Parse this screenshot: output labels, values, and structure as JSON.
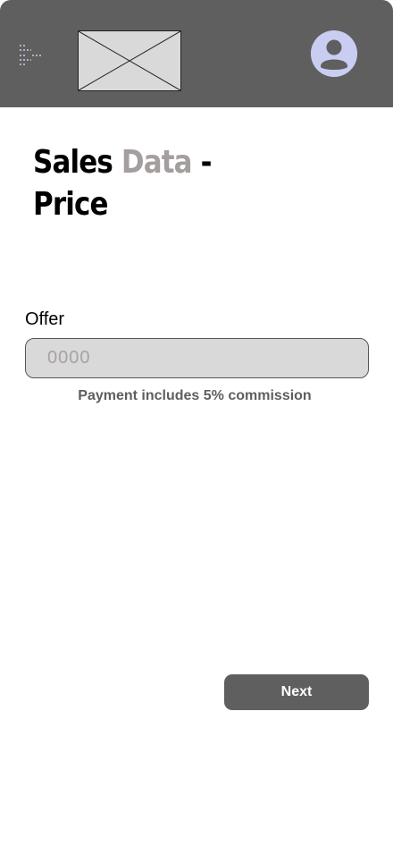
{
  "header": {
    "menu_icon": "menu-icon",
    "logo_icon": "image-placeholder-icon",
    "avatar_icon": "user-avatar-icon",
    "background": "#5f5f5f",
    "avatar_color": "#c9cdf1"
  },
  "title": {
    "word1": "Sales",
    "word2": "Data",
    "dash": "-",
    "line2": "Price",
    "accent_color": "#a59e9e"
  },
  "form": {
    "offer_label": "Offer",
    "offer_placeholder": "0000",
    "offer_value": "",
    "note": "Payment includes 5% commission"
  },
  "footer": {
    "next_label": "Next"
  }
}
